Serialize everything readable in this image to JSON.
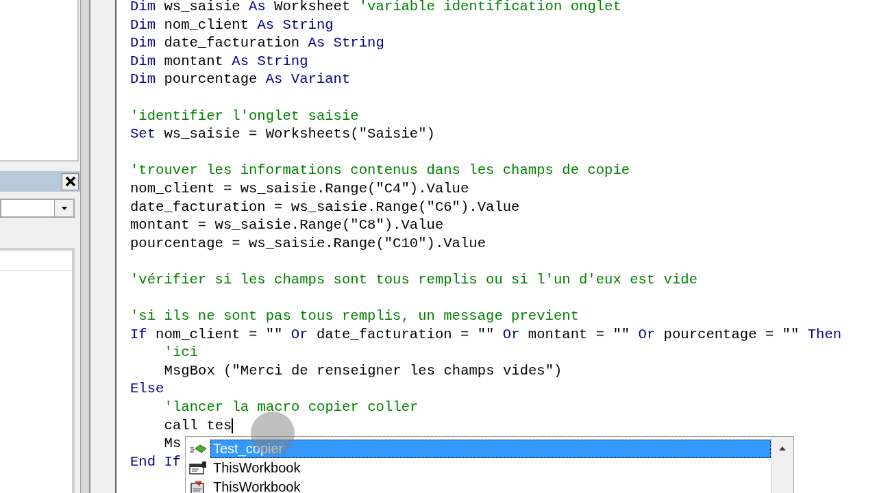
{
  "code_lines": [
    {
      "segments": [
        {
          "kind": "keyword",
          "text": "Dim"
        },
        {
          "kind": "plain",
          "text": " ws_saisie "
        },
        {
          "kind": "keyword",
          "text": "As"
        },
        {
          "kind": "plain",
          "text": " Worksheet "
        },
        {
          "kind": "comment",
          "text": "'variable identification onglet"
        }
      ]
    },
    {
      "segments": [
        {
          "kind": "keyword",
          "text": "Dim"
        },
        {
          "kind": "plain",
          "text": " nom_client "
        },
        {
          "kind": "keyword",
          "text": "As String"
        }
      ]
    },
    {
      "segments": [
        {
          "kind": "keyword",
          "text": "Dim"
        },
        {
          "kind": "plain",
          "text": " date_facturation "
        },
        {
          "kind": "keyword",
          "text": "As String"
        }
      ]
    },
    {
      "segments": [
        {
          "kind": "keyword",
          "text": "Dim"
        },
        {
          "kind": "plain",
          "text": " montant "
        },
        {
          "kind": "keyword",
          "text": "As String"
        }
      ]
    },
    {
      "segments": [
        {
          "kind": "keyword",
          "text": "Dim"
        },
        {
          "kind": "plain",
          "text": " pourcentage "
        },
        {
          "kind": "keyword",
          "text": "As Variant"
        }
      ]
    },
    {
      "blank_before": true,
      "segments": [
        {
          "kind": "comment",
          "text": "'identifier l'onglet saisie"
        }
      ]
    },
    {
      "segments": [
        {
          "kind": "keyword",
          "text": "Set"
        },
        {
          "kind": "plain",
          "text": " ws_saisie = Worksheets(\"Saisie\")"
        }
      ]
    },
    {
      "blank_before": true,
      "segments": [
        {
          "kind": "comment",
          "text": "'trouver les informations contenus dans les champs de copie"
        }
      ]
    },
    {
      "segments": [
        {
          "kind": "plain",
          "text": "nom_client = ws_saisie.Range(\"C4\").Value"
        }
      ]
    },
    {
      "segments": [
        {
          "kind": "plain",
          "text": "date_facturation = ws_saisie.Range(\"C6\").Value"
        }
      ]
    },
    {
      "segments": [
        {
          "kind": "plain",
          "text": "montant = ws_saisie.Range(\"C8\").Value"
        }
      ]
    },
    {
      "segments": [
        {
          "kind": "plain",
          "text": "pourcentage = ws_saisie.Range(\"C10\").Value"
        }
      ]
    },
    {
      "blank_before": true,
      "segments": [
        {
          "kind": "comment",
          "text": "'vérifier si les champs sont tous remplis ou si l'un d'eux est vide"
        }
      ]
    },
    {
      "blank_before": true,
      "segments": [
        {
          "kind": "comment",
          "text": "'si ils ne sont pas tous remplis, un message previent"
        }
      ]
    },
    {
      "segments": [
        {
          "kind": "keyword",
          "text": "If"
        },
        {
          "kind": "plain",
          "text": " nom_client = \"\" "
        },
        {
          "kind": "keyword",
          "text": "Or"
        },
        {
          "kind": "plain",
          "text": " date_facturation = \"\" "
        },
        {
          "kind": "keyword",
          "text": "Or"
        },
        {
          "kind": "plain",
          "text": " montant = \"\" "
        },
        {
          "kind": "keyword",
          "text": "Or"
        },
        {
          "kind": "plain",
          "text": " pourcentage = \"\" "
        },
        {
          "kind": "keyword",
          "text": "Then"
        }
      ]
    },
    {
      "indented": true,
      "segments": [
        {
          "kind": "comment",
          "text": "'ici"
        }
      ]
    },
    {
      "indented": true,
      "segments": [
        {
          "kind": "plain",
          "text": "MsgBox (\"Merci de renseigner les champs vides\")"
        }
      ]
    },
    {
      "segments": [
        {
          "kind": "keyword",
          "text": "Else"
        }
      ]
    },
    {
      "indented": true,
      "segments": [
        {
          "kind": "comment",
          "text": "'lancer la macro copier coller"
        }
      ]
    },
    {
      "indented": true,
      "segments": [
        {
          "kind": "plain",
          "text": "call tes"
        }
      ],
      "caret": true
    },
    {
      "indented": true,
      "segments": [
        {
          "kind": "plain",
          "text": "Ms"
        }
      ]
    },
    {
      "segments": [
        {
          "kind": "keyword",
          "text": "End If"
        }
      ]
    }
  ],
  "autocomplete": {
    "items": [
      {
        "label": "Test_copier",
        "kind": "method",
        "selected": true
      },
      {
        "label": "ThisWorkbook",
        "kind": "object",
        "selected": false
      },
      {
        "label": "ThisWorkbook",
        "kind": "module",
        "selected": false
      }
    ]
  }
}
